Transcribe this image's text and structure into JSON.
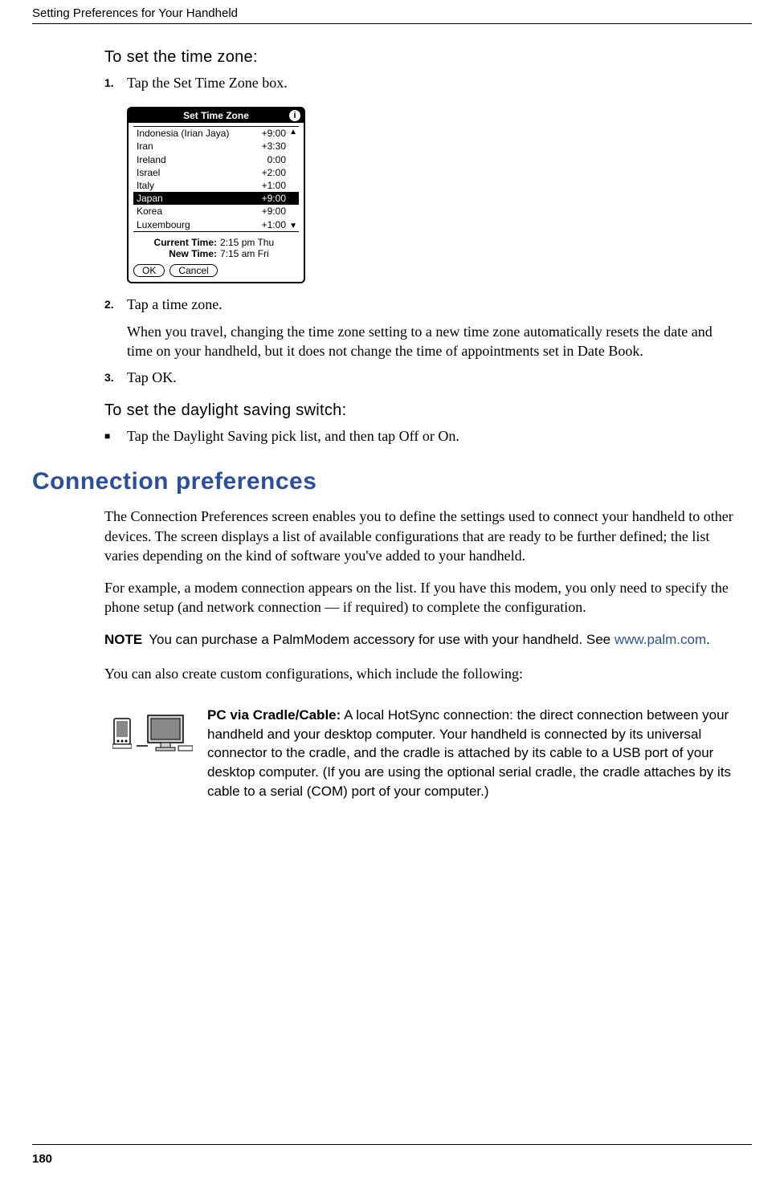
{
  "header": {
    "section": "Setting Preferences for Your Handheld"
  },
  "page_number": "180",
  "time_zone_heading": "To set the time zone:",
  "steps_tz": {
    "s1": {
      "num": "1.",
      "text": "Tap the Set Time Zone box."
    },
    "s2": {
      "num": "2.",
      "text": "Tap a time zone.",
      "detail": "When you travel, changing the time zone setting to a new time zone automatically resets the date and time on your handheld, but it does not change the time of appointments set in Date Book."
    },
    "s3": {
      "num": "3.",
      "text": "Tap OK."
    }
  },
  "tz_widget": {
    "title": "Set Time Zone",
    "rows": [
      {
        "name": "Indonesia (Irian Jaya)",
        "offset": "+9:00"
      },
      {
        "name": "Iran",
        "offset": "+3:30"
      },
      {
        "name": "Ireland",
        "offset": "0:00"
      },
      {
        "name": "Israel",
        "offset": "+2:00"
      },
      {
        "name": "Italy",
        "offset": "+1:00"
      },
      {
        "name": "Japan",
        "offset": "+9:00"
      },
      {
        "name": "Korea",
        "offset": "+9:00"
      },
      {
        "name": "Luxembourg",
        "offset": "+1:00"
      }
    ],
    "selected_index": 5,
    "current_label": "Current Time:",
    "current_value": "2:15 pm Thu",
    "new_label": "New Time:",
    "new_value": "7:15 am Fri",
    "ok": "OK",
    "cancel": "Cancel"
  },
  "dst_heading": "To set the daylight saving switch:",
  "dst_bullet": "Tap the Daylight Saving pick list, and then tap Off or On.",
  "conn_title": "Connection preferences",
  "conn_p1": "The Connection Preferences screen enables you to define the settings used to connect your handheld to other devices. The screen displays a list of available configurations that are ready to be further defined; the list varies depending on the kind of software you've added to your handheld.",
  "conn_p2": "For example, a modem connection appears on the list. If you have this modem, you only need to specify the phone setup (and network connection — if required) to complete the configuration.",
  "note": {
    "label": "NOTE",
    "text_before": "You can purchase a PalmModem accessory for use with your handheld. See ",
    "link": "www.palm.com",
    "text_after": "."
  },
  "conn_p3": "You can also create custom configurations, which include the following:",
  "conn_item": {
    "label": "PC via Cradle/Cable:",
    "text": " A local HotSync connection: the direct connection between your handheld and your desktop computer. Your handheld is connected by its universal connector to the cradle, and the cradle is attached by its cable to a USB port of your desktop computer. (If you are using the optional serial cradle, the cradle attaches by its cable to a serial (COM) port of your computer.)"
  }
}
